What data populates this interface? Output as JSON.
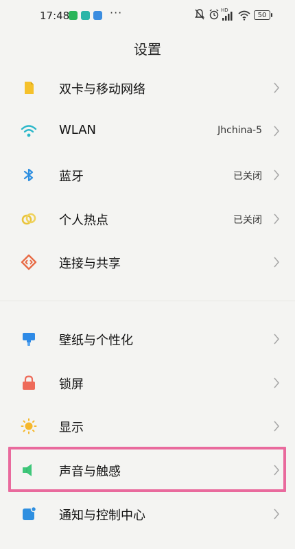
{
  "status_bar": {
    "time": "17:48",
    "more": "···",
    "network_type": "HD",
    "battery": "50"
  },
  "page": {
    "title": "设置"
  },
  "settings": {
    "items": [
      {
        "label": "双卡与移动网络",
        "value": "",
        "icon": "sim-card-icon",
        "icon_color": "#f5c12b"
      },
      {
        "label": "WLAN",
        "value": "Jhchina-5",
        "icon": "wifi-icon",
        "icon_color": "#2bb7c9"
      },
      {
        "label": "蓝牙",
        "value": "已关闭",
        "icon": "bluetooth-icon",
        "icon_color": "#2f8fe0"
      },
      {
        "label": "个人热点",
        "value": "已关闭",
        "icon": "hotspot-icon",
        "icon_color": "#e9c33a"
      },
      {
        "label": "连接与共享",
        "value": "",
        "icon": "connection-share-icon",
        "icon_color": "#e86a45"
      },
      {
        "label": "壁纸与个性化",
        "value": "",
        "icon": "wallpaper-icon",
        "icon_color": "#2e8ae6"
      },
      {
        "label": "锁屏",
        "value": "",
        "icon": "lock-icon",
        "icon_color": "#ee6b5a"
      },
      {
        "label": "显示",
        "value": "",
        "icon": "brightness-icon",
        "icon_color": "#f5b72c"
      },
      {
        "label": "声音与触感",
        "value": "",
        "icon": "speaker-icon",
        "icon_color": "#3fc77a"
      },
      {
        "label": "通知与控制中心",
        "value": "",
        "icon": "notification-center-icon",
        "icon_color": "#2f8fe0"
      }
    ]
  },
  "highlight": {
    "color": "#e96a9d"
  }
}
